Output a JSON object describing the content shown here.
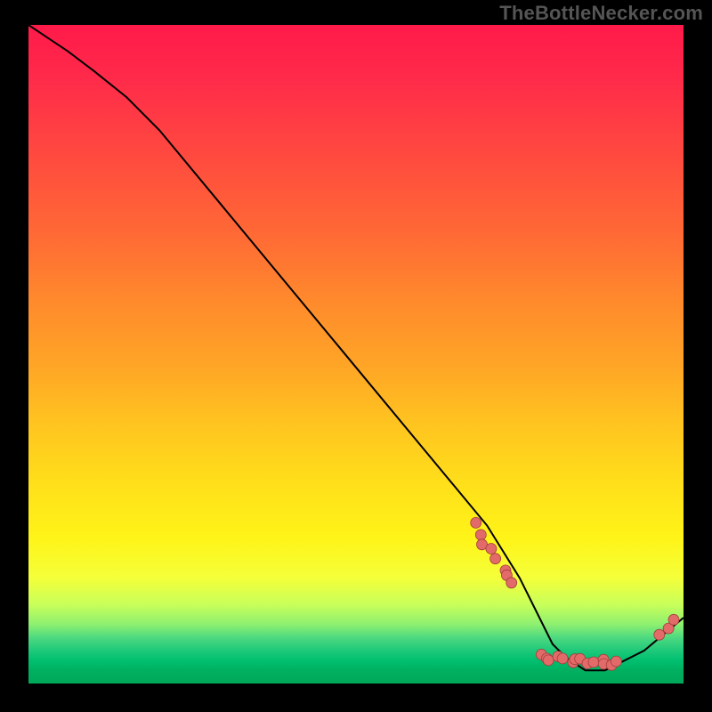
{
  "watermark": "TheBottleNecker.com",
  "chart_data": {
    "type": "line",
    "title": "",
    "xlabel": "",
    "ylabel": "",
    "xlim": [
      0,
      100
    ],
    "ylim": [
      0,
      100
    ],
    "series": [
      {
        "name": "bottleneck-curve",
        "x": [
          0,
          3,
          6,
          10,
          15,
          20,
          30,
          40,
          50,
          60,
          70,
          75,
          78,
          80,
          82,
          85,
          88,
          90,
          94,
          100
        ],
        "y": [
          100,
          98,
          96,
          93,
          89,
          84,
          72,
          60,
          48,
          36,
          24,
          16,
          10,
          6,
          4,
          2,
          2,
          3,
          5,
          10
        ]
      }
    ],
    "points": [
      {
        "name": "cluster-upper",
        "x_range": [
          68,
          74
        ],
        "y_range": [
          24,
          15
        ],
        "count": 8
      },
      {
        "name": "cluster-valley",
        "x_range": [
          78,
          90
        ],
        "y_range": [
          4,
          3
        ],
        "count": 14
      },
      {
        "name": "cluster-tail",
        "x_range": [
          96,
          99
        ],
        "y_range": [
          7,
          10
        ],
        "count": 3
      }
    ],
    "gradient_stops": [
      {
        "pos": 0,
        "color": "#ff1a4a"
      },
      {
        "pos": 50,
        "color": "#ffa626"
      },
      {
        "pos": 80,
        "color": "#fff418"
      },
      {
        "pos": 100,
        "color": "#00a858"
      }
    ]
  }
}
